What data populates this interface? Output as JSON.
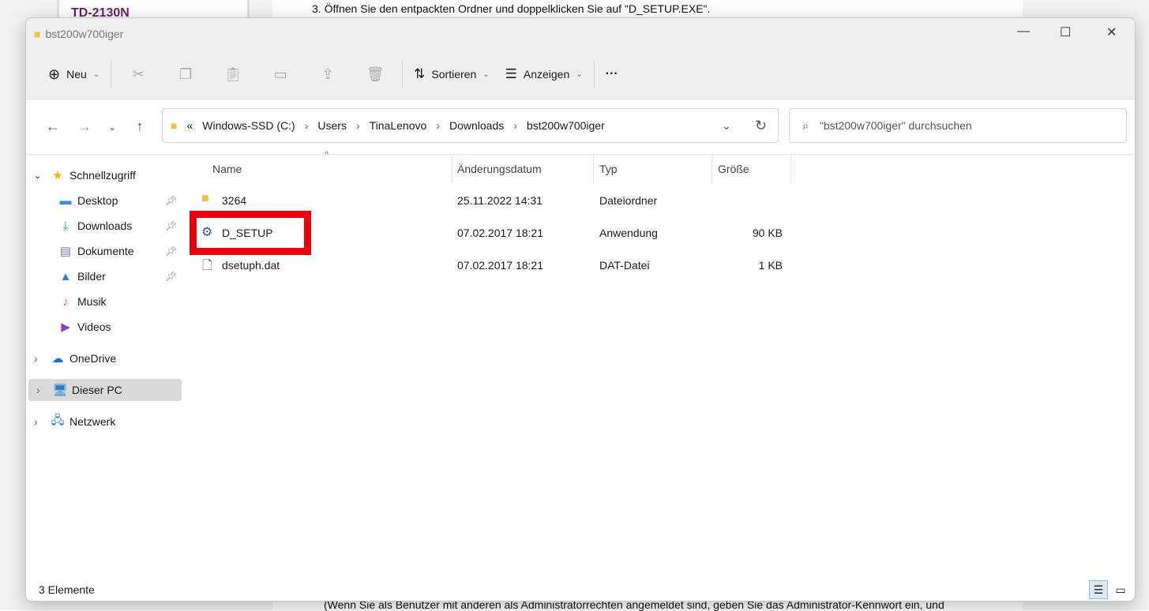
{
  "background": {
    "model": "TD-2130N",
    "step": "3. Öffnen Sie den entpackten Ordner und doppelklicken Sie auf \"D_SETUP.EXE\".",
    "note": "(Wenn Sie als Benutzer mit anderen als Administratorrechten angemeldet sind, geben Sie das Administrator-Kennwort ein, und"
  },
  "window": {
    "title": "bst200w700iger"
  },
  "toolbar": {
    "new": "Neu",
    "sort": "Sortieren",
    "view": "Anzeigen",
    "more": "···"
  },
  "address": {
    "crumbs": [
      "Windows-SSD (C:)",
      "Users",
      "TinaLenovo",
      "Downloads",
      "bst200w700iger"
    ],
    "overflow": "«"
  },
  "search": {
    "placeholder": "\"bst200w700iger\" durchsuchen"
  },
  "sidebar": {
    "quick": "Schnellzugriff",
    "items": [
      "Desktop",
      "Downloads",
      "Dokumente",
      "Bilder",
      "Musik",
      "Videos"
    ],
    "onedrive": "OneDrive",
    "pc": "Dieser PC",
    "network": "Netzwerk"
  },
  "columns": [
    "Name",
    "Änderungsdatum",
    "Typ",
    "Größe"
  ],
  "files": [
    {
      "name": "3264",
      "date": "25.11.2022 14:31",
      "type": "Dateiordner",
      "size": "",
      "icon": "folder-icon"
    },
    {
      "name": "D_SETUP",
      "date": "07.02.2017 18:21",
      "type": "Anwendung",
      "size": "90 KB",
      "icon": "setup-icon"
    },
    {
      "name": "dsetuph.dat",
      "date": "07.02.2017 18:21",
      "type": "DAT-Datei",
      "size": "1 KB",
      "icon": "file-icon"
    }
  ],
  "status": {
    "count": "3 Elemente"
  },
  "colors": {
    "highlight": "#e8000d",
    "folder": "#f3c244"
  }
}
